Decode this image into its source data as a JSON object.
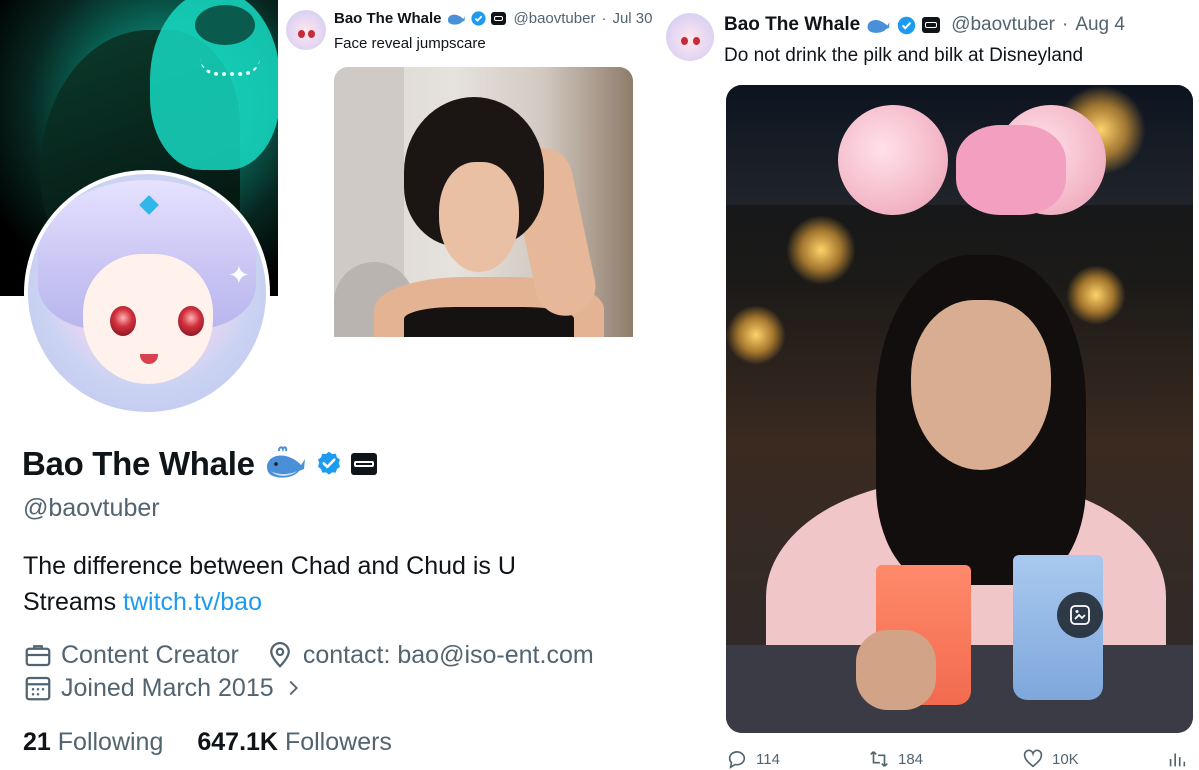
{
  "profile": {
    "display_name": "Bao The Whale",
    "handle": "@baovtuber",
    "bio_text": "The difference between Chad and Chud is U",
    "bio_streams_prefix": "Streams ",
    "bio_link": "twitch.tv/bao",
    "category": "Content Creator",
    "contact": "contact: bao@iso-ent.com",
    "joined": "Joined March 2015",
    "following_count": "21",
    "following_label": "Following",
    "followers_count": "647.1K",
    "followers_label": "Followers",
    "link_color": "#1d9bf0",
    "verified_color": "#1d9bf0"
  },
  "tweets": [
    {
      "display_name": "Bao The Whale",
      "handle": "@baovtuber",
      "dot": "·",
      "date": "Jul 30",
      "text": "Face reveal jumpscare"
    },
    {
      "display_name": "Bao The Whale",
      "handle": "@baovtuber",
      "dot": "·",
      "date": "Aug 4",
      "text": "Do not drink the pilk and bilk at Disneyland",
      "replies": "114",
      "retweets": "184",
      "likes": "10K"
    }
  ],
  "icons": {
    "whale": "whale-emoji",
    "verified": "verified-badge-icon",
    "affiliate": "affiliate-badge-icon",
    "briefcase": "briefcase-icon",
    "location": "location-pin-icon",
    "calendar": "calendar-icon",
    "chevron": "chevron-right-icon",
    "reply": "reply-icon",
    "retweet": "retweet-icon",
    "like": "heart-icon",
    "views": "views-icon",
    "alt": "image-description-icon"
  }
}
